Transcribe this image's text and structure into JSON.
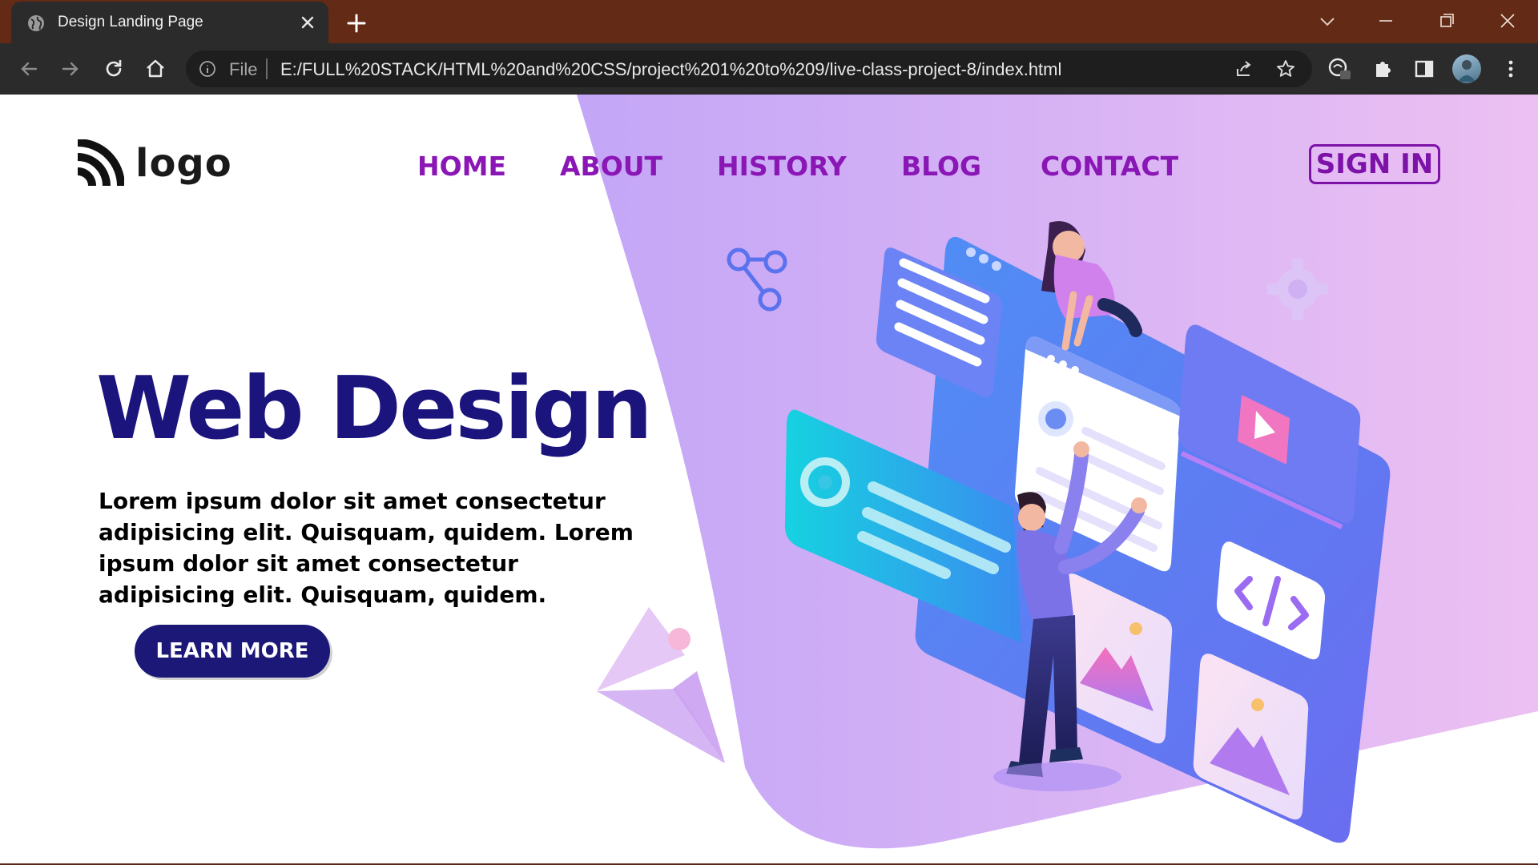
{
  "browser": {
    "tab_title": "Design Landing Page",
    "address_scheme_label": "File",
    "url": "E:/FULL%20STACK/HTML%20and%20CSS/project%201%20to%209/live-class-project-8/index.html"
  },
  "page": {
    "logo_text": "logo",
    "nav": [
      "HOME",
      "ABOUT",
      "HISTORY",
      "BLOG",
      "CONTACT"
    ],
    "signin_label": "SIGN IN",
    "hero_title": "Web Design",
    "hero_text": "Lorem ipsum dolor sit amet consectetur adipisicing elit. Quisquam, quidem. Lorem ipsum dolor sit amet consectetur adipisicing elit. Quisquam, quidem.",
    "cta_label": "LEARN MORE"
  },
  "icons": {
    "tab_favicon": "globe-icon",
    "tab_close": "close-icon",
    "new_tab": "plus-icon",
    "back": "arrow-left-icon",
    "forward": "arrow-right-icon",
    "reload": "reload-icon",
    "home": "home-icon",
    "site_info": "info-icon",
    "share": "share-icon",
    "bookmark": "star-icon",
    "extension_1": "extension-badge-icon",
    "extensions": "puzzle-icon",
    "side_panel": "side-panel-icon",
    "menu": "kebab-menu-icon"
  },
  "colors": {
    "tabbar": "#632b16",
    "toolbar": "#2b2b2b",
    "nav_link": "#8a17b5",
    "hero_title": "#1b147c",
    "cta_background": "#1b1878",
    "shape_gradient_start": "#c6a8f8",
    "shape_gradient_end": "#ecc1f3"
  }
}
